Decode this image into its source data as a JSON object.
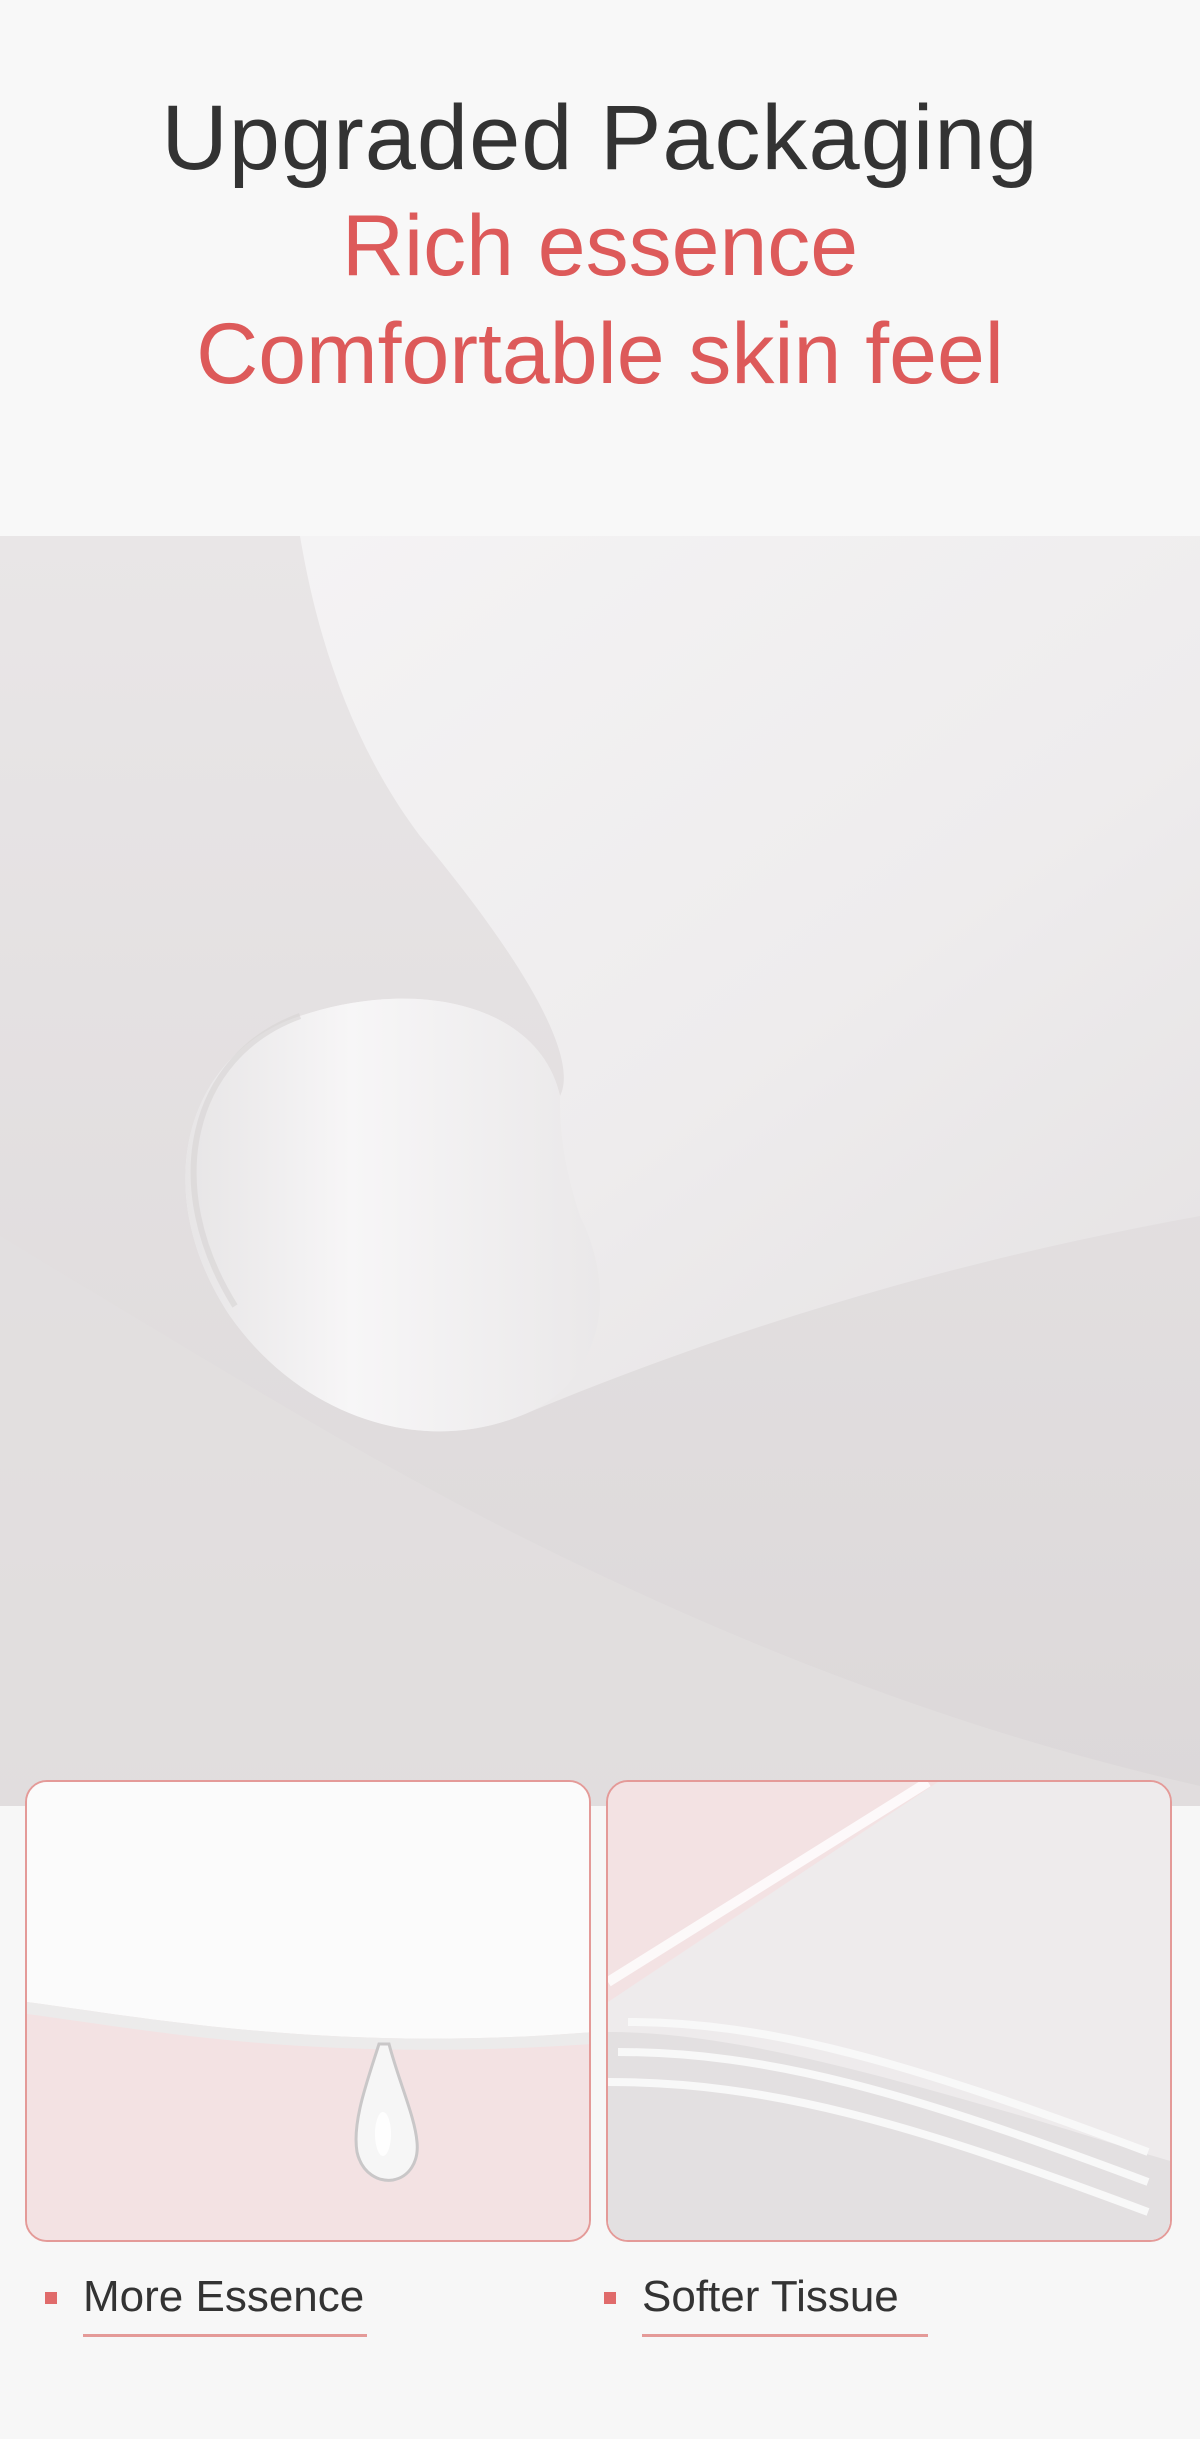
{
  "header": {
    "title": "Upgraded Packaging",
    "subtitle_line1": "Rich essence",
    "subtitle_line2": "Comfortable skin feel"
  },
  "colors": {
    "title": "#333333",
    "accent": "#dd5a5a",
    "panel_border": "#e49a98",
    "panel_background": "#f3e2e3"
  },
  "hero": {
    "image": "folded-white-tissue-photo"
  },
  "features": [
    {
      "label": "More Essence",
      "image": "tissue-with-essence-droplet-photo"
    },
    {
      "label": "Softer Tissue",
      "image": "stacked-soft-tissue-layers-photo"
    }
  ]
}
